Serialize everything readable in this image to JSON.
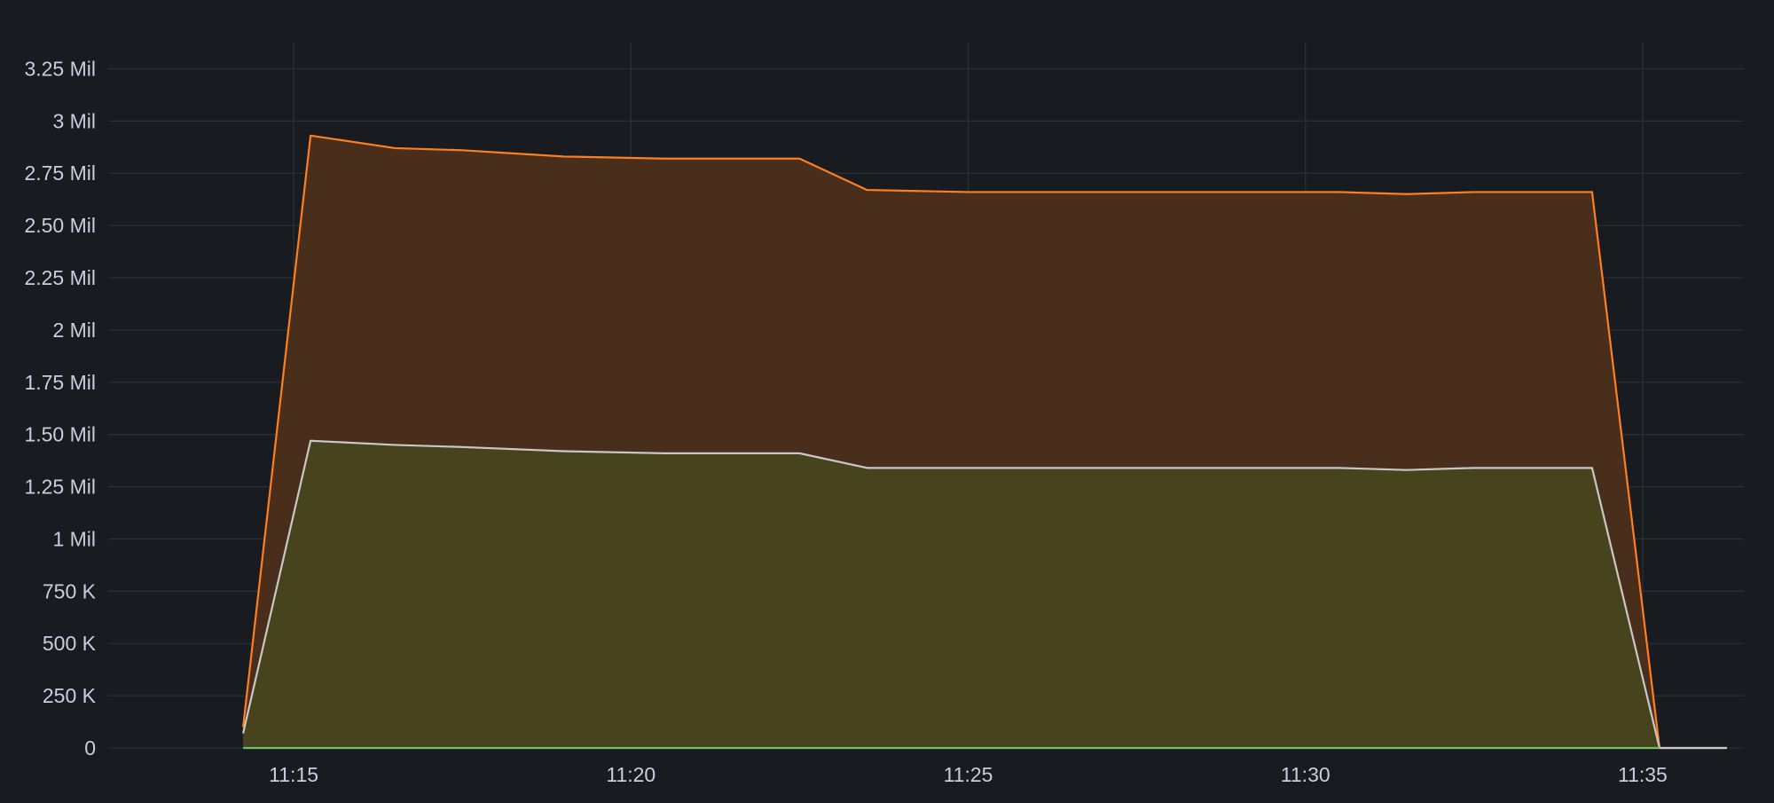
{
  "chart_data": {
    "type": "area",
    "title": "",
    "xlabel": "",
    "ylabel": "",
    "ylim": [
      0,
      3375000
    ],
    "xlim": [
      "11:12:15",
      "11:36:30"
    ],
    "grid": true,
    "legend": "none",
    "y_ticks": [
      {
        "value": 0,
        "label": "0"
      },
      {
        "value": 250000,
        "label": "250 K"
      },
      {
        "value": 500000,
        "label": "500 K"
      },
      {
        "value": 750000,
        "label": "750 K"
      },
      {
        "value": 1000000,
        "label": "1 Mil"
      },
      {
        "value": 1250000,
        "label": "1.25 Mil"
      },
      {
        "value": 1500000,
        "label": "1.50 Mil"
      },
      {
        "value": 1750000,
        "label": "1.75 Mil"
      },
      {
        "value": 2000000,
        "label": "2 Mil"
      },
      {
        "value": 2250000,
        "label": "2.25 Mil"
      },
      {
        "value": 2500000,
        "label": "2.50 Mil"
      },
      {
        "value": 2750000,
        "label": "2.75 Mil"
      },
      {
        "value": 3000000,
        "label": "3 Mil"
      },
      {
        "value": 3250000,
        "label": "3.25 Mil"
      }
    ],
    "x_ticks": [
      {
        "value": "11:15",
        "label": "11:15"
      },
      {
        "value": "11:20",
        "label": "11:20"
      },
      {
        "value": "11:25",
        "label": "11:25"
      },
      {
        "value": "11:30",
        "label": "11:30"
      },
      {
        "value": "11:35",
        "label": "11:35"
      }
    ],
    "series": [
      {
        "color": "#ff7f1f",
        "fill": "#4a2e1c",
        "points": [
          [
            "11:14:15",
            100000
          ],
          [
            "11:15:15",
            2930000
          ],
          [
            "11:16:30",
            2870000
          ],
          [
            "11:17:30",
            2860000
          ],
          [
            "11:19:00",
            2830000
          ],
          [
            "11:20:30",
            2820000
          ],
          [
            "11:22:30",
            2820000
          ],
          [
            "11:23:30",
            2670000
          ],
          [
            "11:25:00",
            2660000
          ],
          [
            "11:27:00",
            2660000
          ],
          [
            "11:29:00",
            2660000
          ],
          [
            "11:30:30",
            2660000
          ],
          [
            "11:31:30",
            2650000
          ],
          [
            "11:32:30",
            2660000
          ],
          [
            "11:34:15",
            2660000
          ],
          [
            "11:35:15",
            0
          ],
          [
            "11:36:15",
            0
          ]
        ]
      },
      {
        "color": "#c8c8c8",
        "fill": "#46431d",
        "points": [
          [
            "11:14:15",
            70000
          ],
          [
            "11:15:15",
            1470000
          ],
          [
            "11:16:30",
            1450000
          ],
          [
            "11:17:30",
            1440000
          ],
          [
            "11:19:00",
            1420000
          ],
          [
            "11:20:30",
            1410000
          ],
          [
            "11:22:30",
            1410000
          ],
          [
            "11:23:30",
            1340000
          ],
          [
            "11:25:00",
            1340000
          ],
          [
            "11:27:00",
            1340000
          ],
          [
            "11:29:00",
            1340000
          ],
          [
            "11:30:30",
            1340000
          ],
          [
            "11:31:30",
            1330000
          ],
          [
            "11:32:30",
            1340000
          ],
          [
            "11:34:15",
            1340000
          ],
          [
            "11:35:15",
            0
          ],
          [
            "11:36:15",
            0
          ]
        ]
      },
      {
        "color": "#73bf69",
        "fill": "none",
        "points": [
          [
            "11:14:15",
            0
          ],
          [
            "11:35:15",
            0
          ]
        ]
      }
    ]
  },
  "colors": {
    "background": "#181b1f",
    "grid": "#2c3035",
    "tick_text": "#ccccdc"
  }
}
